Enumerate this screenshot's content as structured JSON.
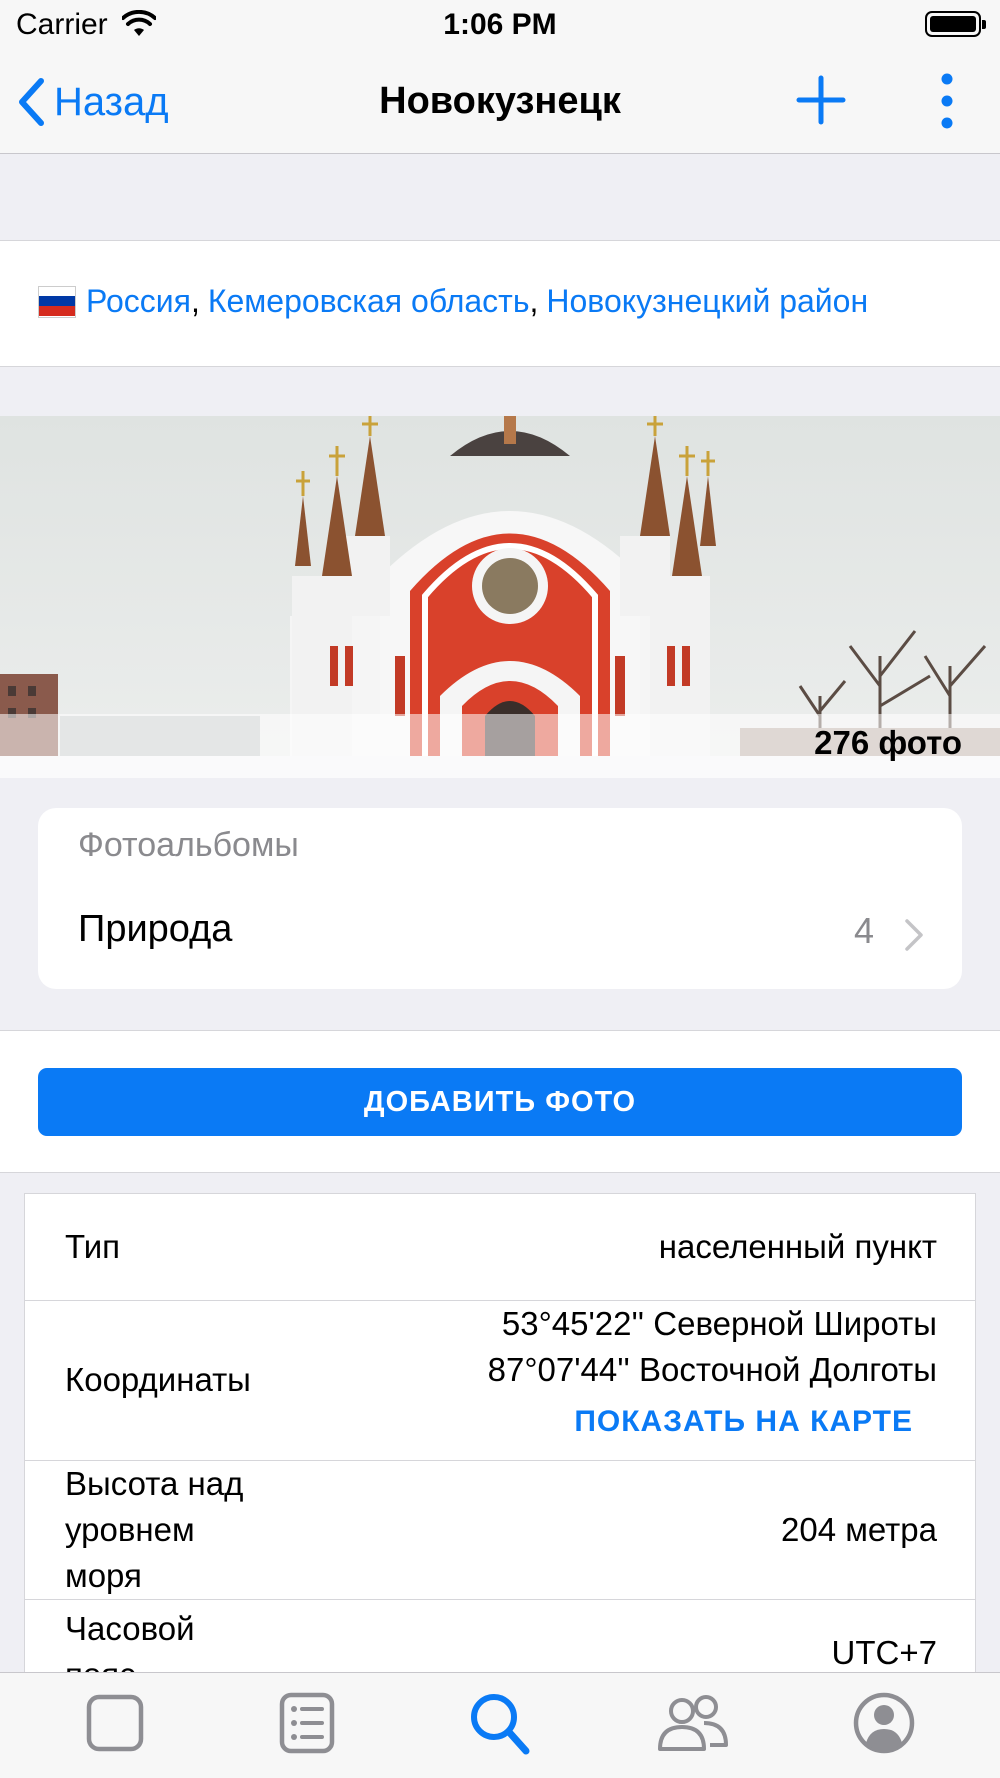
{
  "status_bar": {
    "carrier": "Carrier",
    "time": "1:06 PM",
    "wifi_icon": "wifi-icon",
    "battery_icon": "battery-icon"
  },
  "nav": {
    "back_label": "Назад",
    "title": "Новокузнецк",
    "add_icon": "plus-icon",
    "more_icon": "more-vertical-icon"
  },
  "location": {
    "flag_icon": "russia-flag-icon",
    "items": [
      "Россия",
      "Кемеровская область",
      "Новокузнецкий район"
    ],
    "separators": [
      ",",
      ","
    ]
  },
  "photo": {
    "count": "276 фото"
  },
  "albums": {
    "title": "Фотоальбомы",
    "items": [
      {
        "name": "Природа",
        "count": "4"
      }
    ]
  },
  "add_photo": {
    "label": "ДОБАВИТЬ ФОТО"
  },
  "info": {
    "type": {
      "label": "Тип",
      "value": "населенный пункт"
    },
    "coordinates": {
      "label": "Координаты",
      "latitude": "53°45'22'' Северной Широты",
      "longitude": "87°07'44'' Восточной Долготы",
      "show_map": "ПОКАЗАТЬ НА КАРТЕ"
    },
    "altitude": {
      "label_lines": [
        "Высота над",
        "уровнем",
        "моря"
      ],
      "value": "204 метра"
    },
    "timezone": {
      "label_lines": [
        "Часовой",
        "пояс"
      ],
      "value": "UTC+7"
    }
  },
  "tab_bar": {
    "active_color": "#0a7af5",
    "inactive_color": "#8e8e93",
    "tabs": [
      "square-icon",
      "list-icon",
      "search-icon",
      "people-icon",
      "profile-icon"
    ],
    "active_index": 2
  }
}
